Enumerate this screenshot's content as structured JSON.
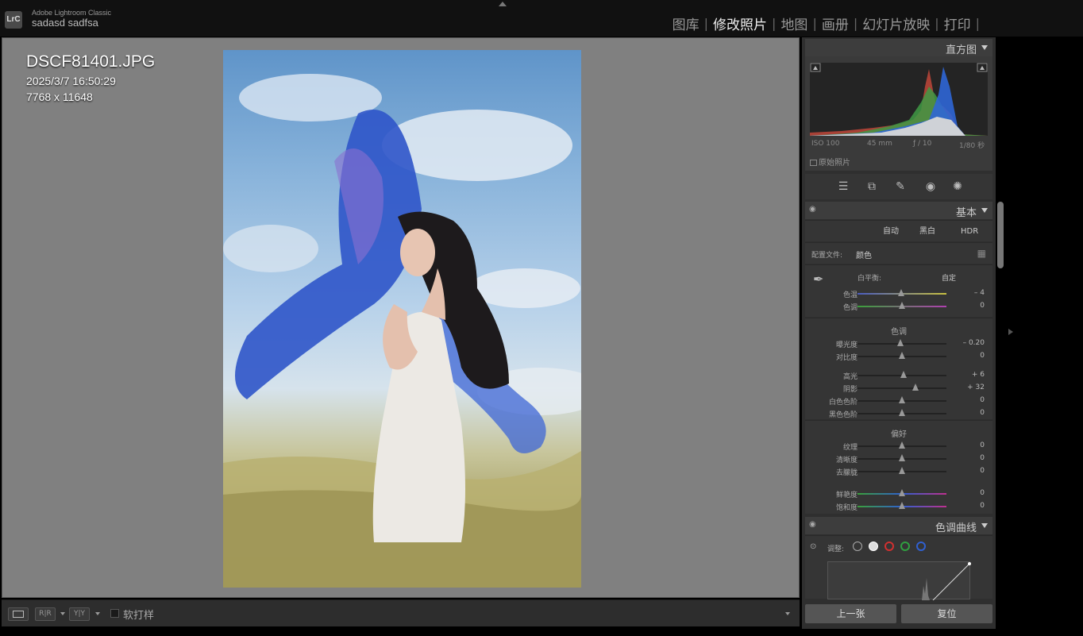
{
  "app": {
    "logo": "LrC",
    "name": "Adobe Lightroom Classic",
    "user": "sadasd sadfsa"
  },
  "modules": [
    {
      "label": "图库",
      "active": false
    },
    {
      "label": "修改照片",
      "active": true
    },
    {
      "label": "地图",
      "active": false
    },
    {
      "label": "画册",
      "active": false
    },
    {
      "label": "幻灯片放映",
      "active": false
    },
    {
      "label": "打印",
      "active": false
    }
  ],
  "photo_info": {
    "filename": "DSCF81401.JPG",
    "datetime": "2025/3/7 16:50:29",
    "dimensions": "7768 x 11648"
  },
  "toolbar": {
    "soft_proof": "软打样"
  },
  "histogram": {
    "title": "直方图",
    "iso": "ISO 100",
    "focal": "45 mm",
    "aperture": "ƒ / 10",
    "shutter": "1/80 秒",
    "original_photo": "原始照片"
  },
  "basic": {
    "title": "基本",
    "auto": "自动",
    "bw": "黑白",
    "hdr": "HDR",
    "profile_label": "配置文件:",
    "profile_value": "颜色",
    "wb_label": "白平衡:",
    "wb_value": "自定",
    "wb_sliders": [
      {
        "label": "色温",
        "value": "– 4",
        "pos": 0.49
      },
      {
        "label": "色调",
        "value": "0",
        "pos": 0.5
      }
    ],
    "tone_title": "色调",
    "tone_sliders_1": [
      {
        "label": "曝光度",
        "value": "– 0.20",
        "pos": 0.48
      },
      {
        "label": "对比度",
        "value": "0",
        "pos": 0.5
      }
    ],
    "tone_sliders_2": [
      {
        "label": "高光",
        "value": "+ 6",
        "pos": 0.52
      },
      {
        "label": "阴影",
        "value": "+ 32",
        "pos": 0.65
      },
      {
        "label": "白色色阶",
        "value": "0",
        "pos": 0.5
      },
      {
        "label": "黑色色阶",
        "value": "0",
        "pos": 0.5
      }
    ],
    "presence_title": "偏好",
    "presence_sliders_1": [
      {
        "label": "纹理",
        "value": "0",
        "pos": 0.5
      },
      {
        "label": "清晰度",
        "value": "0",
        "pos": 0.5
      },
      {
        "label": "去朦胧",
        "value": "0",
        "pos": 0.5
      }
    ],
    "presence_sliders_2": [
      {
        "label": "鲜艳度",
        "value": "0",
        "pos": 0.5
      },
      {
        "label": "饱和度",
        "value": "0",
        "pos": 0.5
      }
    ]
  },
  "tone_curve": {
    "title": "色调曲线",
    "adjust": "调整:"
  },
  "nav": {
    "prev": "上一张",
    "reset": "复位"
  },
  "colors": {
    "accent_temp_left": "#4a5cc0",
    "accent_temp_right": "#c8c040",
    "accent_tint_left": "#3aa03a",
    "accent_tint_right": "#b040b0"
  }
}
